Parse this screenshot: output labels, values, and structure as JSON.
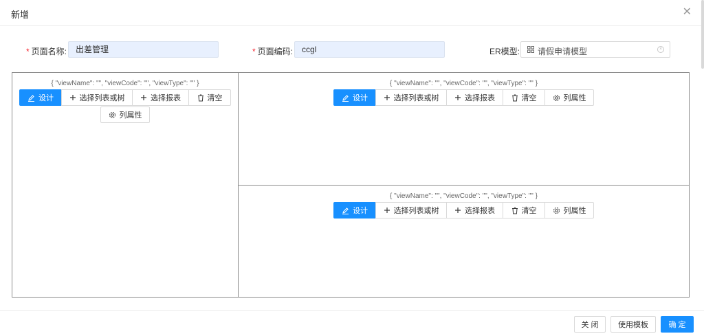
{
  "dialog": {
    "title": "新增",
    "close_glyph": "✕"
  },
  "form": {
    "page_name": {
      "label": "页面名称:",
      "required_mark": "*",
      "value": "出差管理"
    },
    "page_code": {
      "label": "页面编码:",
      "required_mark": "*",
      "value": "ccgl"
    },
    "er_model": {
      "label": "ER模型:",
      "value": "请假申请模型",
      "icon": "grid-icon",
      "clear_icon": "clear-circle-icon",
      "clear_glyph": "×"
    }
  },
  "panels": {
    "left": {
      "json_text": "{ \"viewName\": \"\", \"viewCode\": \"\", \"viewType\": \"\" }",
      "buttons": {
        "design": "设计",
        "select_list_tree": "选择列表或树",
        "select_report": "选择报表",
        "clear": "清空",
        "column_props": "列属性"
      }
    },
    "right_top": {
      "json_text": "{ \"viewName\": \"\", \"viewCode\": \"\", \"viewType\": \"\" }",
      "buttons": {
        "design": "设计",
        "select_list_tree": "选择列表或树",
        "select_report": "选择报表",
        "clear": "清空",
        "column_props": "列属性"
      }
    },
    "right_bottom": {
      "json_text": "{ \"viewName\": \"\", \"viewCode\": \"\", \"viewType\": \"\" }",
      "buttons": {
        "design": "设计",
        "select_list_tree": "选择列表或树",
        "select_report": "选择报表",
        "clear": "清空",
        "column_props": "列属性"
      }
    }
  },
  "footer": {
    "close_label": "关 闭",
    "use_template_label": "使用模板",
    "confirm_label": "确 定"
  },
  "colors": {
    "primary": "#1890ff",
    "required": "#f5222d",
    "input_filled_bg": "#e8f0fe",
    "panel_border": "#8c8c8c"
  }
}
